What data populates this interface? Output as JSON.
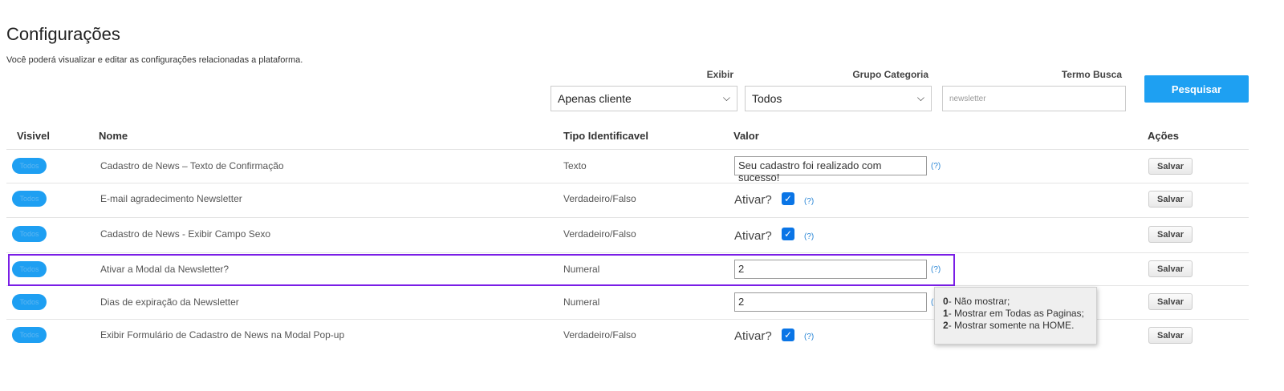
{
  "page": {
    "title": "Configurações",
    "subtitle": "Você poderá visualizar e editar as configurações relacionadas a plataforma."
  },
  "filters": {
    "exibir_label": "Exibir",
    "exibir_value": "Apenas cliente",
    "grupo_label": "Grupo Categoria",
    "grupo_value": "Todos",
    "termo_label": "Termo Busca",
    "termo_value": "newsletter",
    "search_label": "Pesquisar"
  },
  "table": {
    "headers": {
      "visivel": "Visivel",
      "nome": "Nome",
      "tipo": "Tipo Identificavel",
      "valor": "Valor",
      "acoes": "Ações"
    },
    "rows": [
      {
        "toggle": "Todos",
        "name": "Cadastro de News – Texto de Confirmação",
        "type": "Texto",
        "kind": "text",
        "value": "Seu cadastro foi realizado com sucesso!",
        "help": "(?)",
        "save": "Salvar"
      },
      {
        "toggle": "Todos",
        "name": "E-mail agradecimento Newsletter",
        "type": "Verdadeiro/Falso",
        "kind": "bool",
        "ativar": "Ativar?",
        "checked": true,
        "help": "(?)",
        "save": "Salvar"
      },
      {
        "toggle": "Todos",
        "name": "Cadastro de News - Exibir Campo Sexo",
        "type": "Verdadeiro/Falso",
        "kind": "bool",
        "ativar": "Ativar?",
        "checked": true,
        "help": "(?)",
        "save": "Salvar"
      },
      {
        "toggle": "Todos",
        "name": "Ativar a Modal da Newsletter?",
        "type": "Numeral",
        "kind": "number",
        "value": "2",
        "help": "(?)",
        "save": "Salvar"
      },
      {
        "toggle": "Todos",
        "name": "Dias de expiração da Newsletter",
        "type": "Numeral",
        "kind": "number",
        "value": "2",
        "help": "(",
        "save": "Salvar"
      },
      {
        "toggle": "Todos",
        "name": "Exibir Formulário de Cadastro de News na Modal Pop-up",
        "type": "Verdadeiro/Falso",
        "kind": "bool",
        "ativar": "Ativar?",
        "checked": true,
        "help": "(?)",
        "save": "Salvar"
      }
    ]
  },
  "tooltip": {
    "lines": [
      {
        "num": "0",
        "text": "- Não mostrar;"
      },
      {
        "num": "1",
        "text": "- Mostrar em Todas as Paginas;"
      },
      {
        "num": "2",
        "text": "- Mostrar somente na HOME."
      }
    ]
  },
  "colors": {
    "accent": "#1ea0f2",
    "highlight": "#7a1ee6",
    "checkbox": "#0a75e6",
    "help_link": "#2a86d6"
  }
}
